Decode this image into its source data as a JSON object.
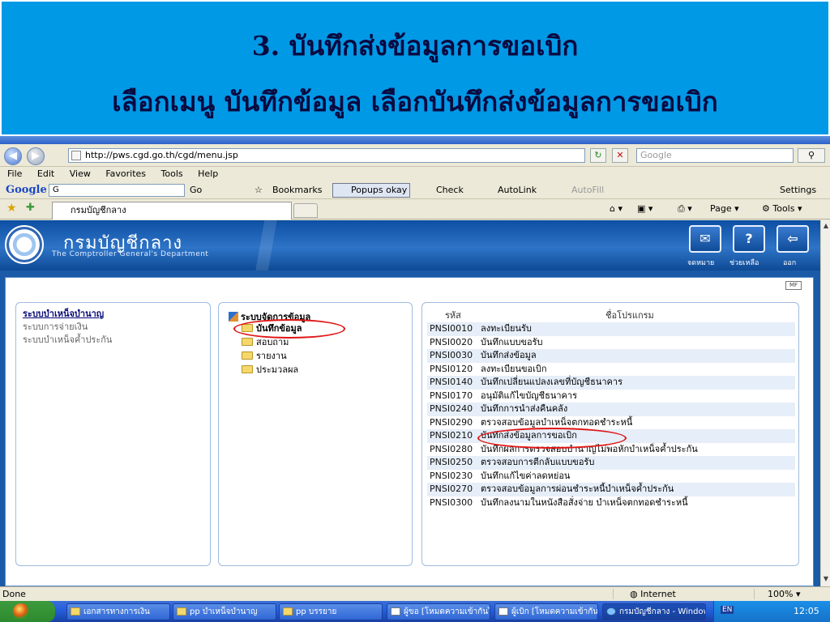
{
  "slide": {
    "title": "3. บันทึกส่งข้อมูลการขอเบิก",
    "subtitle": "เลือกเมนู บันทึกข้อมูล  เลือกบันทึกส่งข้อมูลการขอเบิก"
  },
  "browser": {
    "url": "http://pws.cgd.go.th/cgd/menu.jsp",
    "search_placeholder": "Google",
    "menu": [
      "File",
      "Edit",
      "View",
      "Favorites",
      "Tools",
      "Help"
    ],
    "google_toolbar": {
      "logo": "Google",
      "go": "Go",
      "bookmarks": "Bookmarks",
      "popups": "Popups okay",
      "check": "Check",
      "autolink": "AutoLink",
      "autofill": "AutoFill",
      "settings": "Settings"
    },
    "tab_title": "กรมบัญชีกลาง",
    "command_bar": {
      "page": "Page",
      "tools": "Tools"
    },
    "status": {
      "left": "Done",
      "zone": "Internet",
      "zoom": "100%"
    }
  },
  "site": {
    "name": "กรมบัญชีกลาง",
    "subtitle": "The Comptroller General's Department",
    "header_buttons": [
      {
        "label": "จดหมาย",
        "icon": "mail-icon"
      },
      {
        "label": "ช่วยเหลือ",
        "icon": "help-icon"
      },
      {
        "label": "ออก",
        "icon": "logout-icon"
      }
    ]
  },
  "systems": [
    "ระบบบำเหน็จบำนาญ",
    "ระบบการจ่ายเงิน",
    "ระบบบำเหน็จค้ำประกัน"
  ],
  "tree": {
    "root": "ระบบจัดการข้อมูล",
    "nodes": [
      "บันทึกข้อมูล",
      "สอบถาม",
      "รายงาน",
      "ประมวลผล"
    ]
  },
  "programs": {
    "headers": {
      "code": "รหัส",
      "name": "ชื่อโปรแกรม"
    },
    "rows": [
      {
        "code": "PNSI0010",
        "name": "ลงทะเบียนรับ"
      },
      {
        "code": "PNSI0020",
        "name": "บันทึกแบบขอรับ"
      },
      {
        "code": "PNSI0030",
        "name": "บันทึกส่งข้อมูล"
      },
      {
        "code": "PNSI0120",
        "name": "ลงทะเบียนขอเบิก"
      },
      {
        "code": "PNSI0140",
        "name": "บันทึกเปลี่ยนแปลงเลขที่บัญชีธนาคาร"
      },
      {
        "code": "PNSI0170",
        "name": "อนุมัติแก้ไขบัญชีธนาคาร"
      },
      {
        "code": "PNSI0240",
        "name": "บันทึกการนำส่งคืนคลัง"
      },
      {
        "code": "PNSI0290",
        "name": "ตรวจสอบข้อมูลบำเหน็จตกทอดชำระหนี้"
      },
      {
        "code": "PNSI0210",
        "name": "บันทึกส่งข้อมูลการขอเบิก"
      },
      {
        "code": "PNSI0280",
        "name": "บันทึกผลการตรวจสอบบำนาญไม่พอหักบำเหน็จค้ำประกัน"
      },
      {
        "code": "PNSI0250",
        "name": "ตรวจสอบการตีกลับแบบขอรับ"
      },
      {
        "code": "PNSI0230",
        "name": "บันทึกแก้ไขค่าลดหย่อน"
      },
      {
        "code": "PNSI0270",
        "name": "ตรวจสอบข้อมูลการผ่อนชำระหนี้บำเหน็จค้ำประกัน"
      },
      {
        "code": "PNSI0300",
        "name": "บันทึกลงนามในหนังสือสั่งจ่าย บำเหน็จตกทอดชำระหนี้"
      }
    ]
  },
  "taskbar": {
    "items": [
      "เอกสารทางการเงิน",
      "pp บำเหน็จบำนาญ",
      "pp บรรยาย",
      "ผู้ขอ [โหมดความเข้ากันได้]",
      "ผู้เบิก [โหมดความเข้ากันได้]",
      "กรมบัญชีกลาง - Windows Internet Explorer"
    ],
    "lang": "EN",
    "clock": "12:05"
  },
  "colors": {
    "banner": "#0099E6",
    "highlight_ring": "#E01515",
    "site_header": "#1A5AA6"
  }
}
